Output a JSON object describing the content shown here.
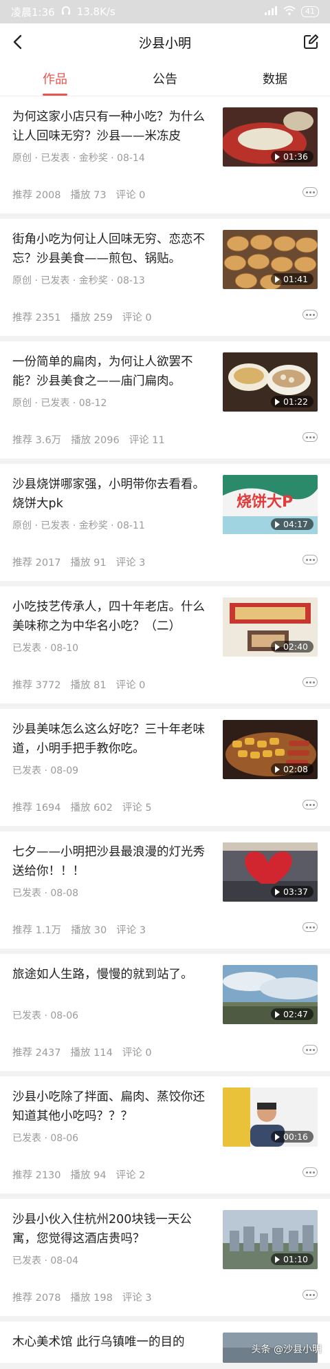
{
  "statusbar": {
    "time": "凌晨1:36",
    "speed": "13.8K/s",
    "battery": "41"
  },
  "header": {
    "title": "沙县小明"
  },
  "tabs": [
    {
      "label": "作品",
      "active": true
    },
    {
      "label": "公告",
      "active": false
    },
    {
      "label": "数据",
      "active": false
    }
  ],
  "items": [
    {
      "title": "为何这家小店只有一种小吃？为什么让人回味无穷？沙县——米冻皮",
      "meta": "原创 · 已发表 · 金秒奖 · 08-14",
      "recommend": "推荐 2008",
      "plays": "播放 73",
      "comments": "评论 0",
      "duration": "01:36",
      "thumb_theme": "red-bowl"
    },
    {
      "title": "街角小吃为何让人回味无穷、恋恋不忘？沙县美食——煎包、锅贴。",
      "meta": "原创 · 已发表 · 金秒奖 · 08-13",
      "recommend": "推荐 2351",
      "plays": "播放 259",
      "comments": "评论 0",
      "duration": "01:41",
      "thumb_theme": "buns"
    },
    {
      "title": "一份简单的扁肉，为何让人欲罢不能？沙县美食之——庙门扁肉。",
      "meta": "原创 · 已发表 · 08-12",
      "recommend": "推荐 3.6万",
      "plays": "播放 2096",
      "comments": "评论 11",
      "duration": "01:22",
      "thumb_theme": "bowls"
    },
    {
      "title": "沙县烧饼哪家强，小明带你去看看。烧饼大pk",
      "meta": "原创 · 已发表 · 金秒奖 · 08-11",
      "recommend": "推荐 2017",
      "plays": "播放 91",
      "comments": "评论 3",
      "duration": "04:17",
      "thumb_theme": "banner",
      "thumb_text": "烧饼大P"
    },
    {
      "title": "小吃技艺传承人，四十年老店。什么美味称之为中华名小吃？（二）",
      "meta": "已发表 · 08-10",
      "recommend": "推荐 3772",
      "plays": "播放 81",
      "comments": "评论 0",
      "duration": "02:40",
      "thumb_theme": "shop"
    },
    {
      "title": "沙县美味怎么这么好吃？三十年老味道，小明手把手教你吃。",
      "meta": "已发表 · 08-09",
      "recommend": "推荐 1694",
      "plays": "播放 602",
      "comments": "评论 5",
      "duration": "02:08",
      "thumb_theme": "fried"
    },
    {
      "title": "七夕——小明把沙县最浪漫的灯光秀送给你！！！",
      "meta": "已发表 · 08-08",
      "recommend": "推荐 1.1万",
      "plays": "播放 30",
      "comments": "评论 3",
      "duration": "03:37",
      "thumb_theme": "heart"
    },
    {
      "title": "旅途如人生路，慢慢的就到站了。",
      "meta": "已发表 · 08-06",
      "recommend": "推荐 2437",
      "plays": "播放 114",
      "comments": "评论 0",
      "duration": "02:47",
      "thumb_theme": "sky"
    },
    {
      "title": "沙县小吃除了拌面、扁肉、蒸饺你还知道其他小吃吗？？？",
      "meta": "已发表 · 08-06",
      "recommend": "推荐 2130",
      "plays": "播放 94",
      "comments": "评论 2",
      "duration": "00:16",
      "thumb_theme": "person"
    },
    {
      "title": "沙县小伙入住杭州200块钱一天公寓，您觉得这酒店贵吗？",
      "meta": "已发表 · 08-04",
      "recommend": "推荐 2078",
      "plays": "播放 198",
      "comments": "评论 3",
      "duration": "01:10",
      "thumb_theme": "city"
    }
  ],
  "partial_item": {
    "title": "木心美术馆  此行乌镇唯一的目的"
  },
  "watermark": {
    "text": "头条 @沙县小明"
  }
}
